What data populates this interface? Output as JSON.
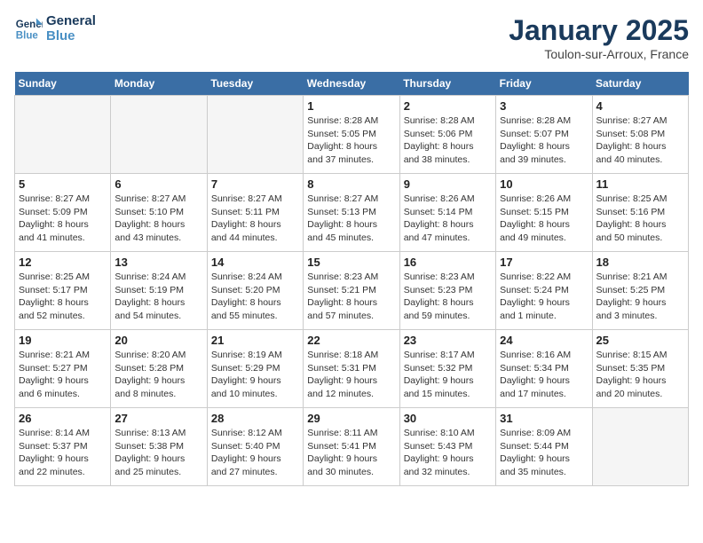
{
  "logo": {
    "line1": "General",
    "line2": "Blue"
  },
  "title": "January 2025",
  "location": "Toulon-sur-Arroux, France",
  "weekdays": [
    "Sunday",
    "Monday",
    "Tuesday",
    "Wednesday",
    "Thursday",
    "Friday",
    "Saturday"
  ],
  "weeks": [
    [
      {
        "day": "",
        "info": ""
      },
      {
        "day": "",
        "info": ""
      },
      {
        "day": "",
        "info": ""
      },
      {
        "day": "1",
        "info": "Sunrise: 8:28 AM\nSunset: 5:05 PM\nDaylight: 8 hours\nand 37 minutes."
      },
      {
        "day": "2",
        "info": "Sunrise: 8:28 AM\nSunset: 5:06 PM\nDaylight: 8 hours\nand 38 minutes."
      },
      {
        "day": "3",
        "info": "Sunrise: 8:28 AM\nSunset: 5:07 PM\nDaylight: 8 hours\nand 39 minutes."
      },
      {
        "day": "4",
        "info": "Sunrise: 8:27 AM\nSunset: 5:08 PM\nDaylight: 8 hours\nand 40 minutes."
      }
    ],
    [
      {
        "day": "5",
        "info": "Sunrise: 8:27 AM\nSunset: 5:09 PM\nDaylight: 8 hours\nand 41 minutes."
      },
      {
        "day": "6",
        "info": "Sunrise: 8:27 AM\nSunset: 5:10 PM\nDaylight: 8 hours\nand 43 minutes."
      },
      {
        "day": "7",
        "info": "Sunrise: 8:27 AM\nSunset: 5:11 PM\nDaylight: 8 hours\nand 44 minutes."
      },
      {
        "day": "8",
        "info": "Sunrise: 8:27 AM\nSunset: 5:13 PM\nDaylight: 8 hours\nand 45 minutes."
      },
      {
        "day": "9",
        "info": "Sunrise: 8:26 AM\nSunset: 5:14 PM\nDaylight: 8 hours\nand 47 minutes."
      },
      {
        "day": "10",
        "info": "Sunrise: 8:26 AM\nSunset: 5:15 PM\nDaylight: 8 hours\nand 49 minutes."
      },
      {
        "day": "11",
        "info": "Sunrise: 8:25 AM\nSunset: 5:16 PM\nDaylight: 8 hours\nand 50 minutes."
      }
    ],
    [
      {
        "day": "12",
        "info": "Sunrise: 8:25 AM\nSunset: 5:17 PM\nDaylight: 8 hours\nand 52 minutes."
      },
      {
        "day": "13",
        "info": "Sunrise: 8:24 AM\nSunset: 5:19 PM\nDaylight: 8 hours\nand 54 minutes."
      },
      {
        "day": "14",
        "info": "Sunrise: 8:24 AM\nSunset: 5:20 PM\nDaylight: 8 hours\nand 55 minutes."
      },
      {
        "day": "15",
        "info": "Sunrise: 8:23 AM\nSunset: 5:21 PM\nDaylight: 8 hours\nand 57 minutes."
      },
      {
        "day": "16",
        "info": "Sunrise: 8:23 AM\nSunset: 5:23 PM\nDaylight: 8 hours\nand 59 minutes."
      },
      {
        "day": "17",
        "info": "Sunrise: 8:22 AM\nSunset: 5:24 PM\nDaylight: 9 hours\nand 1 minute."
      },
      {
        "day": "18",
        "info": "Sunrise: 8:21 AM\nSunset: 5:25 PM\nDaylight: 9 hours\nand 3 minutes."
      }
    ],
    [
      {
        "day": "19",
        "info": "Sunrise: 8:21 AM\nSunset: 5:27 PM\nDaylight: 9 hours\nand 6 minutes."
      },
      {
        "day": "20",
        "info": "Sunrise: 8:20 AM\nSunset: 5:28 PM\nDaylight: 9 hours\nand 8 minutes."
      },
      {
        "day": "21",
        "info": "Sunrise: 8:19 AM\nSunset: 5:29 PM\nDaylight: 9 hours\nand 10 minutes."
      },
      {
        "day": "22",
        "info": "Sunrise: 8:18 AM\nSunset: 5:31 PM\nDaylight: 9 hours\nand 12 minutes."
      },
      {
        "day": "23",
        "info": "Sunrise: 8:17 AM\nSunset: 5:32 PM\nDaylight: 9 hours\nand 15 minutes."
      },
      {
        "day": "24",
        "info": "Sunrise: 8:16 AM\nSunset: 5:34 PM\nDaylight: 9 hours\nand 17 minutes."
      },
      {
        "day": "25",
        "info": "Sunrise: 8:15 AM\nSunset: 5:35 PM\nDaylight: 9 hours\nand 20 minutes."
      }
    ],
    [
      {
        "day": "26",
        "info": "Sunrise: 8:14 AM\nSunset: 5:37 PM\nDaylight: 9 hours\nand 22 minutes."
      },
      {
        "day": "27",
        "info": "Sunrise: 8:13 AM\nSunset: 5:38 PM\nDaylight: 9 hours\nand 25 minutes."
      },
      {
        "day": "28",
        "info": "Sunrise: 8:12 AM\nSunset: 5:40 PM\nDaylight: 9 hours\nand 27 minutes."
      },
      {
        "day": "29",
        "info": "Sunrise: 8:11 AM\nSunset: 5:41 PM\nDaylight: 9 hours\nand 30 minutes."
      },
      {
        "day": "30",
        "info": "Sunrise: 8:10 AM\nSunset: 5:43 PM\nDaylight: 9 hours\nand 32 minutes."
      },
      {
        "day": "31",
        "info": "Sunrise: 8:09 AM\nSunset: 5:44 PM\nDaylight: 9 hours\nand 35 minutes."
      },
      {
        "day": "",
        "info": ""
      }
    ]
  ]
}
